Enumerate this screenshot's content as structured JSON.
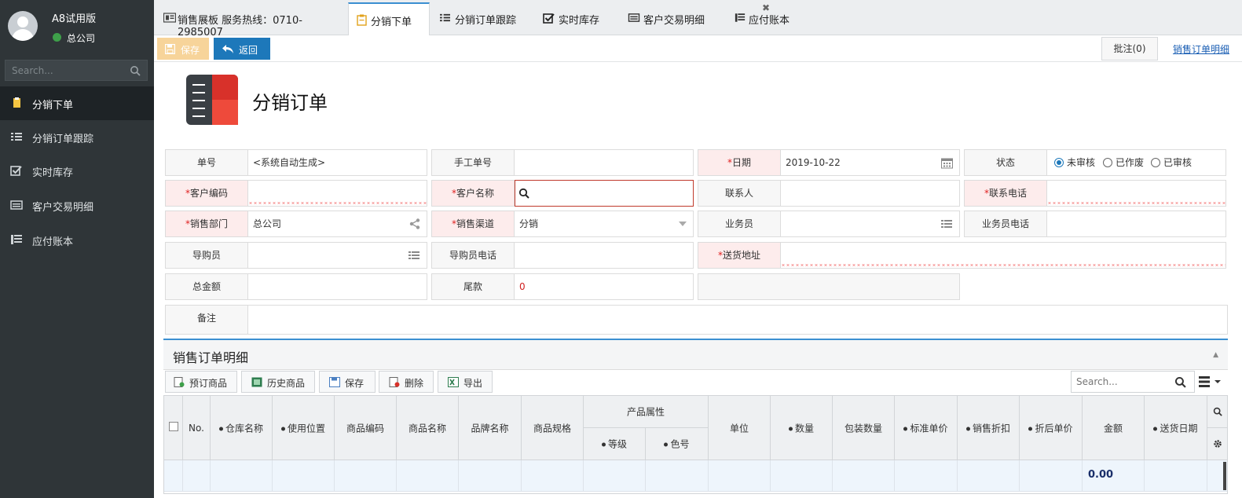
{
  "sidebar": {
    "user_name": "A8试用版",
    "company": "总公司",
    "search_placeholder": "Search...",
    "items": [
      {
        "label": "分销下单",
        "icon": "clipboard-icon",
        "active": true
      },
      {
        "label": "分销订单跟踪",
        "icon": "list-icon",
        "active": false
      },
      {
        "label": "实时库存",
        "icon": "checkbox-icon",
        "active": false
      },
      {
        "label": "客户交易明细",
        "icon": "card-icon",
        "active": false
      },
      {
        "label": "应付账本",
        "icon": "ledger-icon",
        "active": false
      }
    ]
  },
  "tabs": [
    {
      "label": "销售展板 服务热线：0710-2985007",
      "icon": "board-icon"
    },
    {
      "label": "分销下单",
      "icon": "clipboard-icon",
      "active": true
    },
    {
      "label": "分销订单跟踪",
      "icon": "list-icon"
    },
    {
      "label": "实时库存",
      "icon": "checkbox-icon",
      "closable": true
    },
    {
      "label": "客户交易明细",
      "icon": "card-icon"
    },
    {
      "label": "应付账本",
      "icon": "ledger-icon"
    }
  ],
  "toolbar": {
    "save_label": "保存",
    "back_label": "返回",
    "note_label": "批注(0)",
    "detail_link": "销售订单明细"
  },
  "page_title": "分销订单",
  "form": {
    "order_no": {
      "label": "单号",
      "value": "<系统自动生成>"
    },
    "manual_no": {
      "label": "手工单号",
      "value": ""
    },
    "date": {
      "label": "日期",
      "value": "2019-10-22"
    },
    "status": {
      "label": "状态",
      "options": [
        "未审核",
        "已作废",
        "已审核"
      ],
      "selected": "未审核"
    },
    "customer_code": {
      "label": "客户编码",
      "value": ""
    },
    "customer_name": {
      "label": "客户名称",
      "value": ""
    },
    "contact": {
      "label": "联系人",
      "value": ""
    },
    "contact_phone": {
      "label": "联系电话",
      "value": ""
    },
    "sales_dept": {
      "label": "销售部门",
      "value": "总公司"
    },
    "sales_channel": {
      "label": "销售渠道",
      "value": "分销"
    },
    "salesman": {
      "label": "业务员",
      "value": ""
    },
    "salesman_phone": {
      "label": "业务员电话",
      "value": ""
    },
    "guide": {
      "label": "导购员",
      "value": ""
    },
    "guide_phone": {
      "label": "导购员电话",
      "value": ""
    },
    "delivery_address": {
      "label": "送货地址",
      "value": ""
    },
    "total_amount": {
      "label": "总金额",
      "value": ""
    },
    "balance": {
      "label": "尾款",
      "value": "0"
    },
    "remark": {
      "label": "备注",
      "value": ""
    },
    "required_mark": "*"
  },
  "detail": {
    "title": "销售订单明细",
    "buttons": [
      "预订商品",
      "历史商品",
      "保存",
      "删除",
      "导出"
    ],
    "search_placeholder": "Search...",
    "columns": {
      "no": "No.",
      "warehouse": "仓库名称",
      "location": "使用位置",
      "item_code": "商品编码",
      "item_name": "商品名称",
      "brand": "品牌名称",
      "spec": "商品规格",
      "attr_group": "产品属性",
      "grade": "等级",
      "color": "色号",
      "unit": "单位",
      "qty": "数量",
      "pack_qty": "包装数量",
      "std_price": "标准单价",
      "discount": "销售折扣",
      "net_price": "折后单价",
      "amount": "金额",
      "delivery_date": "送货日期"
    },
    "total_amount": "0.00"
  },
  "colors": {
    "accent": "#1d78ba",
    "sidebar_bg": "#2f3538",
    "save_btn": "#f7d49a",
    "required_bg": "#fdecec"
  }
}
